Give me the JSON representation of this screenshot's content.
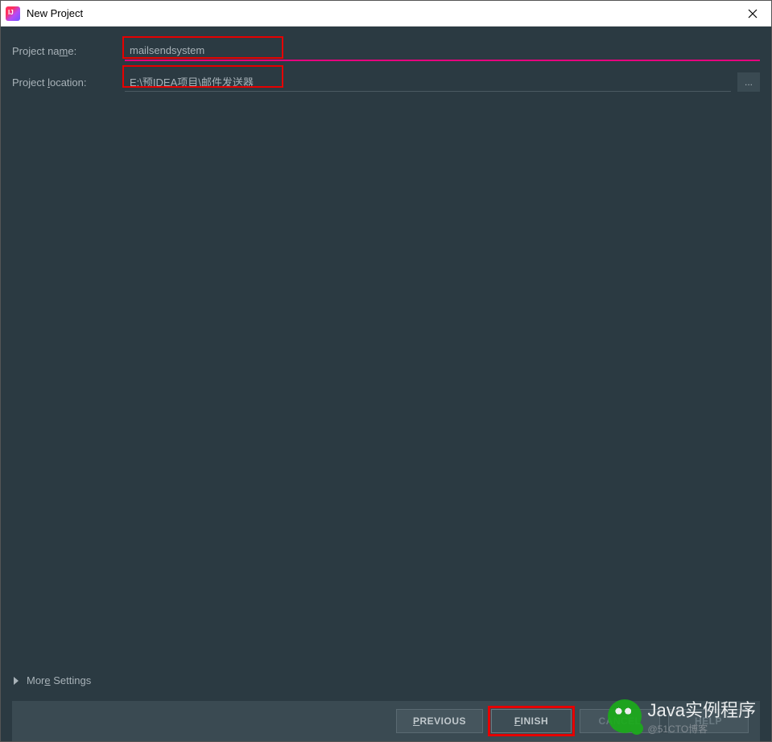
{
  "window": {
    "title": "New Project"
  },
  "form": {
    "projectNameLabel": "Project name:",
    "projectNameValue": "mailsendsystem",
    "projectLocationLabel": "Project location:",
    "projectLocationValue": "E:\\预IDEA项目\\邮件发送器",
    "browseTooltip": "..."
  },
  "moreSettings": {
    "label": "More Settings"
  },
  "buttons": {
    "previous": "PREVIOUS",
    "finish": "FINISH",
    "cancel": "CANCEL",
    "help": "HELP"
  },
  "watermark": {
    "title": "Java实例程序",
    "sub": "@51CTO博客"
  }
}
